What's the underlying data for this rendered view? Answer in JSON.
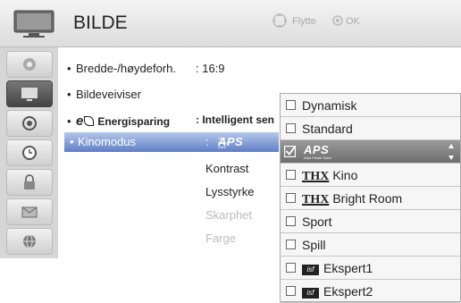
{
  "header": {
    "title": "BILDE",
    "help_move": "Flytte",
    "help_ok": "OK"
  },
  "sidebar": {
    "items": [
      "picture-settings",
      "picture",
      "audio",
      "time",
      "lock",
      "options",
      "network"
    ],
    "active_index": 1
  },
  "menu": {
    "aspect_label": "Bredde-/høydeforh.",
    "aspect_value": ": 16:9",
    "wizard_label": "Bildeveiviser",
    "energy_icon_text": "e",
    "energy_label": "Energisparing",
    "energy_value": ": Intelligent sen",
    "mode_label": "Kinomodus",
    "mode_colon": ":",
    "aps_logo": "APS",
    "aps_sub": "Auto Power Save",
    "sub_items": [
      "Kontrast",
      "Lysstyrke",
      "Skarphet",
      "Farge"
    ]
  },
  "dropdown": {
    "options": [
      {
        "label": "Dynamisk"
      },
      {
        "label": "Standard"
      },
      {
        "label": "APS",
        "sub": "Auto Power Save"
      },
      {
        "thx": "THX",
        "label": "Kino"
      },
      {
        "thx": "THX",
        "label": "Bright Room"
      },
      {
        "label": "Sport"
      },
      {
        "label": "Spill"
      },
      {
        "isf": "isf",
        "label": "Ekspert1"
      },
      {
        "isf": "isf",
        "label": "Ekspert2"
      }
    ],
    "selected_index": 2
  },
  "colors": {
    "highlight": "#5e7ec5",
    "selected_option": "#7a7a7a",
    "sidebar": "#d6d6d6"
  }
}
